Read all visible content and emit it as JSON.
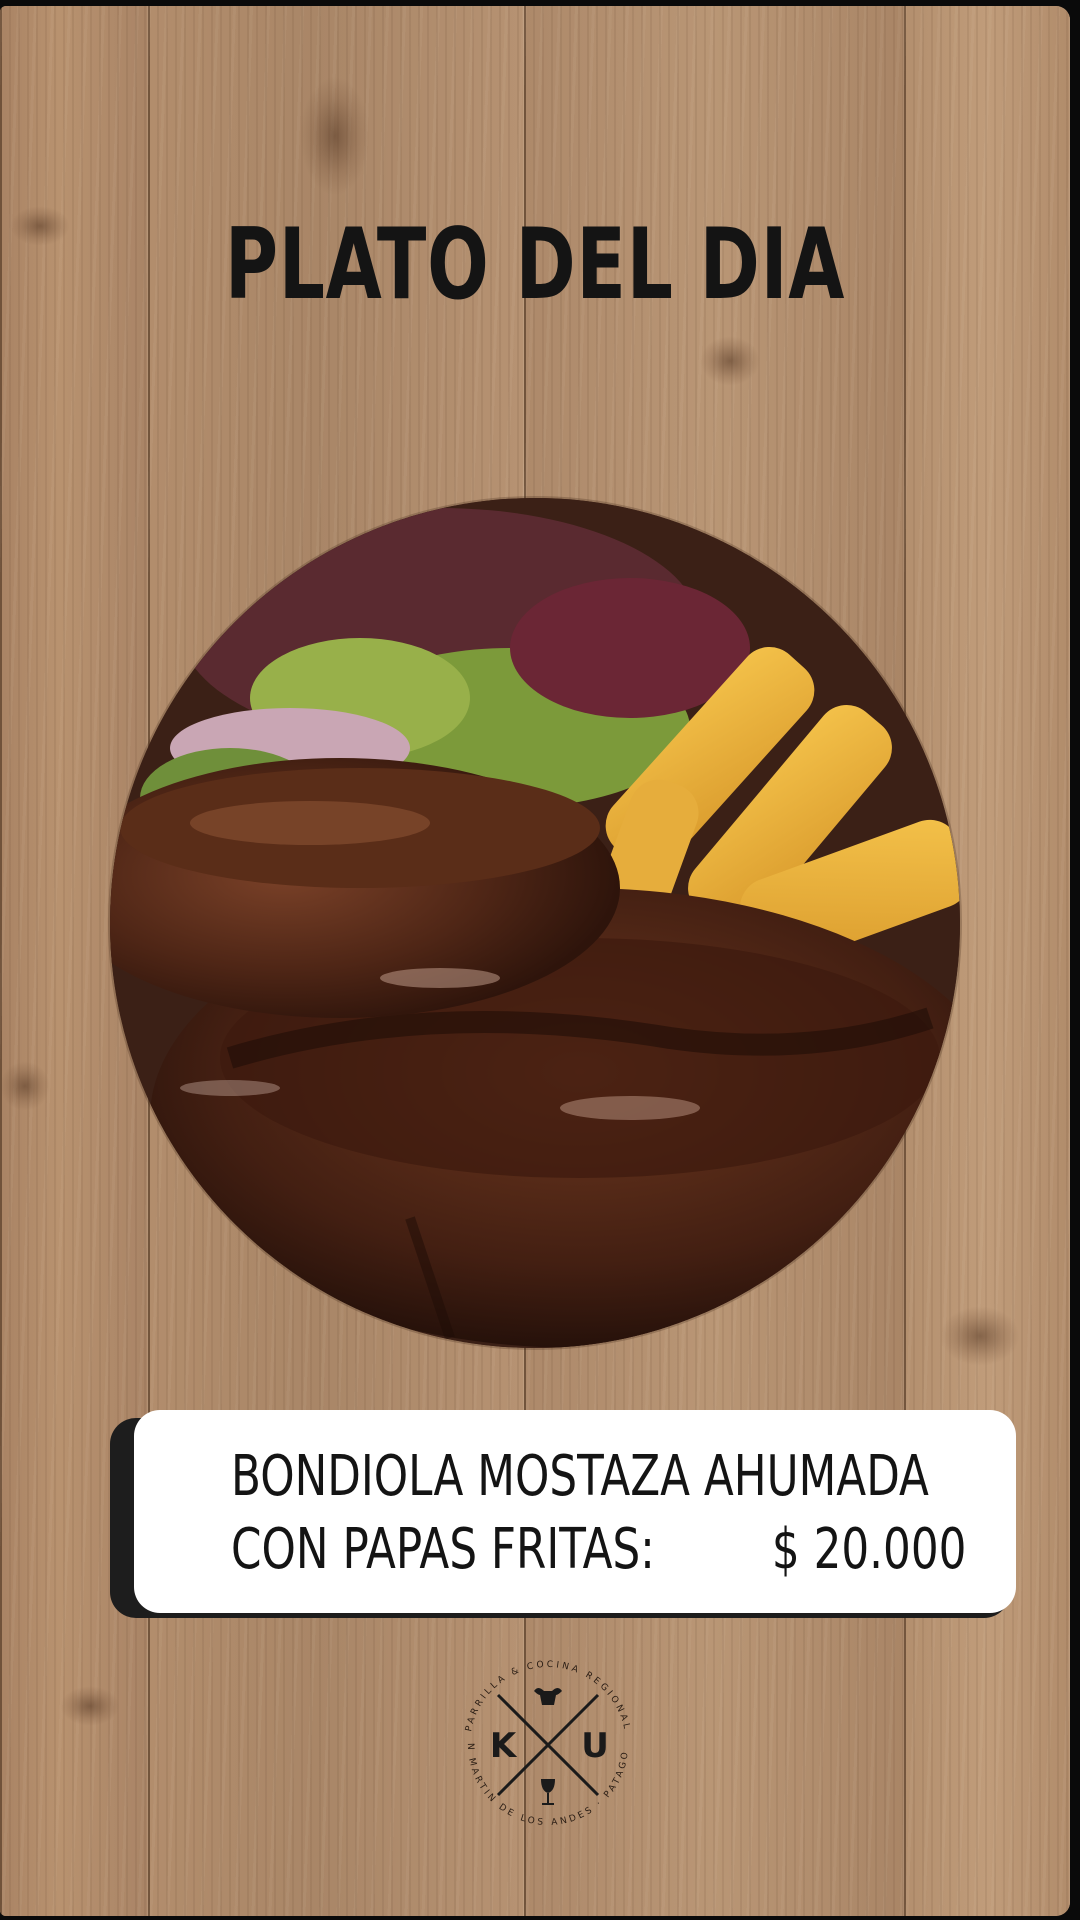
{
  "title": "PLATO DEL DIA",
  "dish": {
    "line1": "BONDIOLA MOSTAZA AHUMADA",
    "line2_label": "CON PAPAS FRITAS:",
    "price": "$ 20.000"
  },
  "photo": {
    "icon": "steak-with-fries-photo"
  },
  "logo": {
    "left_letter": "K",
    "right_letter": "U",
    "ring_text_top": "PARRILLA & COCINA REGIONAL",
    "ring_text_bottom": "SAN MARTIN DE LOS ANDES · PATAGONIA",
    "icons": [
      "bull-head-icon",
      "wine-glass-icon"
    ]
  },
  "colors": {
    "wood": "#b08b6a",
    "text": "#141414",
    "card": "#ffffff",
    "card_shadow": "#1d1d1d"
  }
}
